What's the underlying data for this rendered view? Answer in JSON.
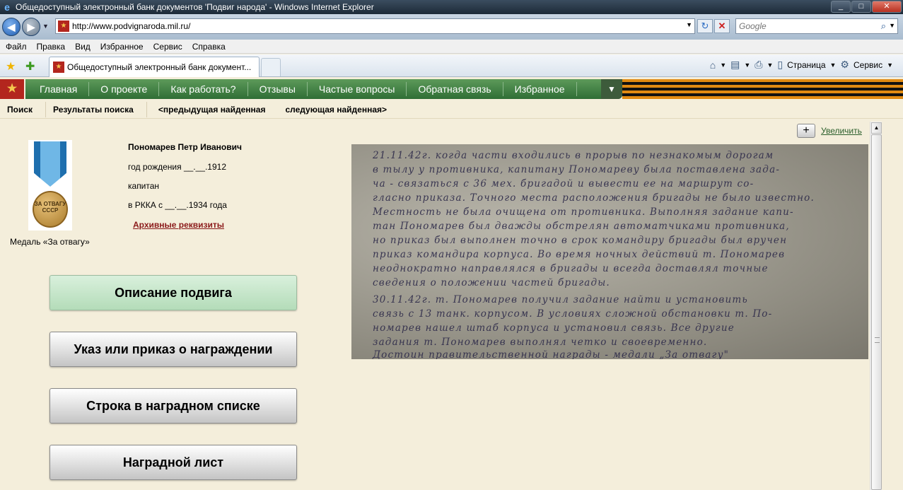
{
  "window": {
    "title": "Общедоступный электронный банк документов 'Подвиг народа' - Windows Internet Explorer",
    "min_icon": "minimize-icon",
    "max_icon": "maximize-icon",
    "close_icon": "close-icon"
  },
  "address_bar": {
    "url": "http://www.podvignaroda.mil.ru/",
    "search_placeholder": "Google"
  },
  "menu": [
    "Файл",
    "Правка",
    "Вид",
    "Избранное",
    "Сервис",
    "Справка"
  ],
  "tabs": [
    {
      "label": "Общедоступный электронный банк документ..."
    }
  ],
  "command_bar": {
    "page_label": "Страница",
    "tools_label": "Сервис"
  },
  "site_nav": [
    "Главная",
    "О проекте",
    "Как работать?",
    "Отзывы",
    "Частые вопросы",
    "Обратная связь",
    "Избранное"
  ],
  "search_nav": {
    "search": "Поиск",
    "results": "Результаты поиска",
    "prev": "<предыдущая найденная",
    "next": "следующая найденная>"
  },
  "medal": {
    "caption": "Медаль «За отвагу»",
    "inscription": "ЗА ОТВАГУ СССР"
  },
  "person": {
    "name": "Пономарев Петр Иванович",
    "birth": "год рождения __.__.1912",
    "rank": "капитан",
    "service": "в РККА с __.__.1934 года",
    "archive_link": "Архивные реквизиты"
  },
  "buttons": {
    "feat": "Описание подвига",
    "decree": "Указ или приказ о награждении",
    "list_row": "Строка в наградном списке",
    "award_sheet": "Наградной лист"
  },
  "zoom": {
    "link": "Увеличить"
  },
  "colors": {
    "page_bg": "#f4eedb",
    "nav_green": "#3f7d43",
    "link_dark_red": "#8b1a1a",
    "active_button": "#c6e6ca"
  }
}
